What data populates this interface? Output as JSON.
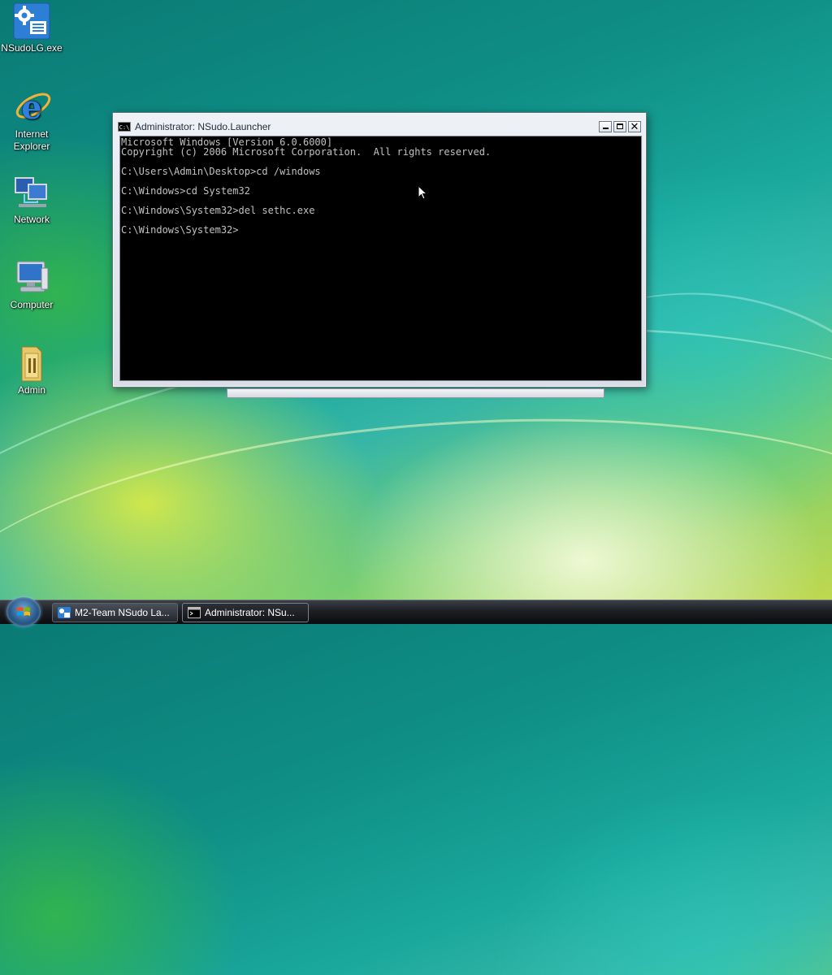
{
  "desktop": {
    "icons": [
      {
        "label": "NSudoLG.exe",
        "icon": "nsudo-gear-icon"
      },
      {
        "label": "Internet Explorer",
        "icon": "internet-explorer-icon"
      },
      {
        "label": "Network",
        "icon": "network-icon"
      },
      {
        "label": "Computer",
        "icon": "computer-icon"
      },
      {
        "label": "Admin",
        "icon": "user-folder-icon"
      }
    ]
  },
  "window": {
    "title": "Administrator: NSudo.Launcher",
    "icon": "console-icon",
    "title_icon_text": "C:\\",
    "close_glyph": "✕",
    "console_text": "Microsoft Windows [Version 6.0.6000]\nCopyright (c) 2006 Microsoft Corporation.  All rights reserved.\n\nC:\\Users\\Admin\\Desktop>cd /windows\n\nC:\\Windows>cd System32\n\nC:\\Windows\\System32>del sethc.exe\n\nC:\\Windows\\System32>"
  },
  "taskbar": {
    "start_icon": "windows-start-orb-icon",
    "buttons": [
      {
        "label": "M2-Team NSudo La...",
        "icon": "nsudo-app-icon",
        "active": false
      },
      {
        "label": "Administrator: NSu...",
        "icon": "console-icon",
        "active": true
      }
    ]
  },
  "colors": {
    "console_background": "#000000",
    "console_text": "#c0c0c0",
    "taskbar": "#1c1f24"
  }
}
